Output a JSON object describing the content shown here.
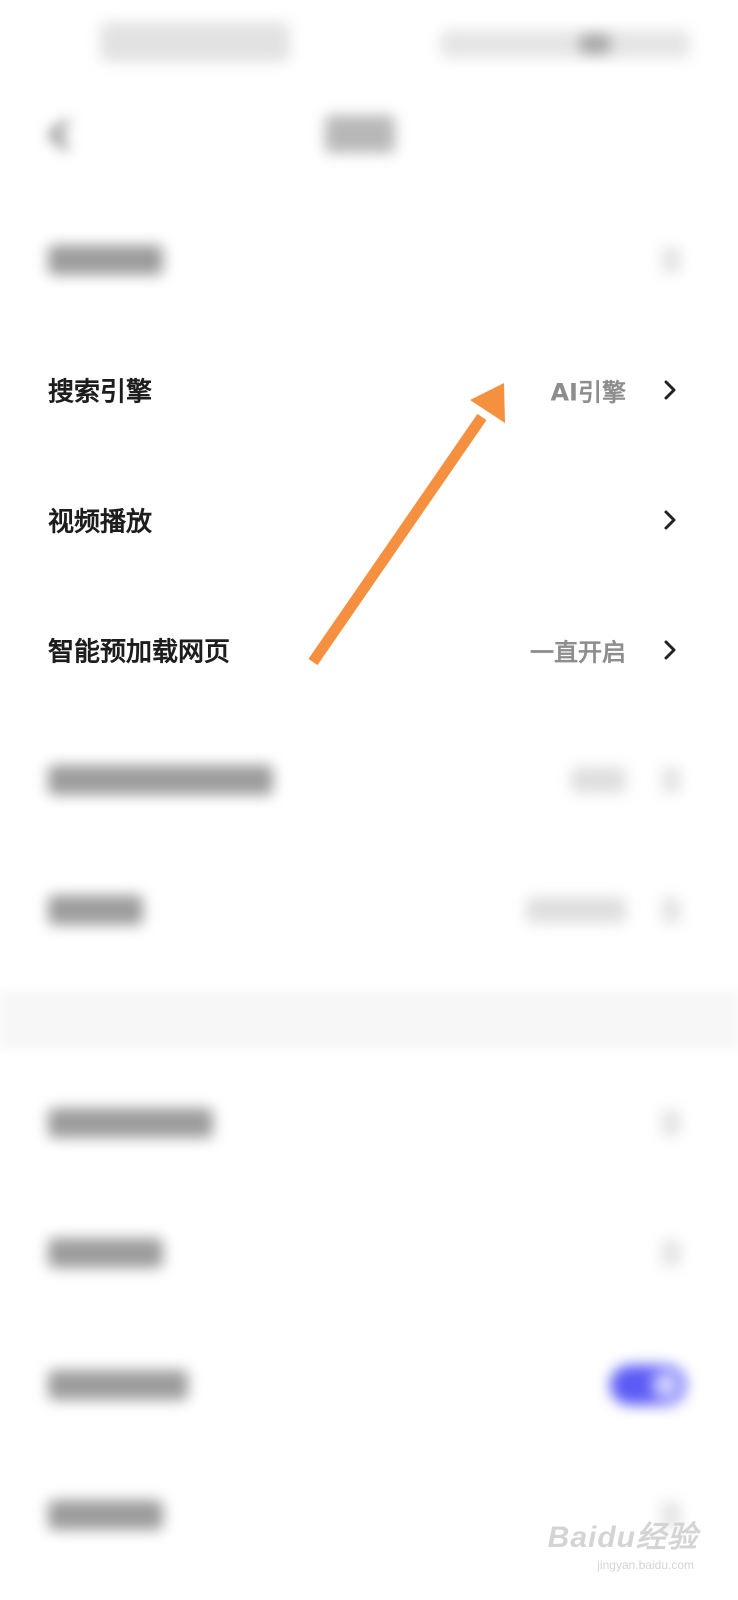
{
  "settings": {
    "rows": [
      {
        "label": "搜索引擎",
        "value": "AI引擎"
      },
      {
        "label": "视频播放",
        "value": ""
      },
      {
        "label": "智能预加载网页",
        "value": "一直开启"
      }
    ]
  },
  "colors": {
    "annotation_arrow": "#F59040",
    "toggle_on": "#3F3FF5",
    "label_text": "#1D1D1D",
    "value_text": "#8D8D8D"
  },
  "watermark": {
    "main": "Baidu经验",
    "sub": "jingyan.baidu.com"
  }
}
